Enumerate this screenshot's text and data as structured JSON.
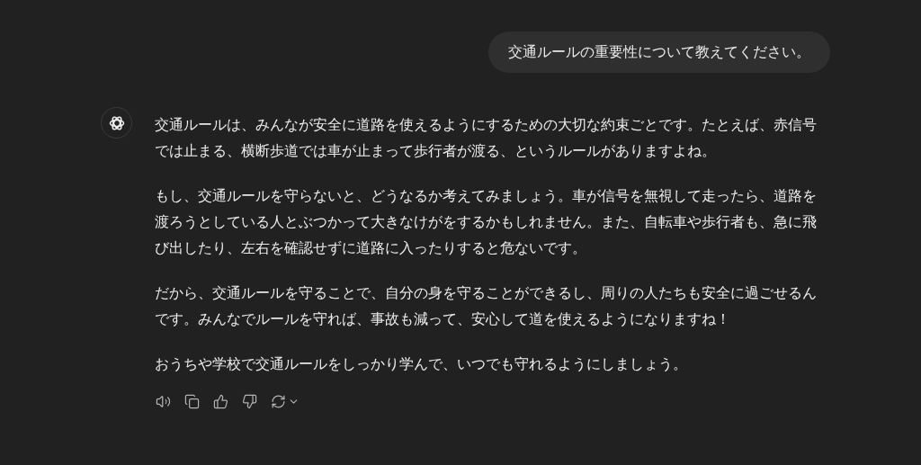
{
  "user_message": "交通ルールの重要性について教えてください。",
  "assistant_message": {
    "paragraphs": [
      "交通ルールは、みんなが安全に道路を使えるようにするための大切な約束ごとです。たとえば、赤信号では止まる、横断歩道では車が止まって歩行者が渡る、というルールがありますよね。",
      "もし、交通ルールを守らないと、どうなるか考えてみましょう。車が信号を無視して走ったら、道路を渡ろうとしている人とぶつかって大きなけがをするかもしれません。また、自転車や歩行者も、急に飛び出したり、左右を確認せずに道路に入ったりすると危ないです。",
      "だから、交通ルールを守ることで、自分の身を守ることができるし、周りの人たちも安全に過ごせるんです。みんなでルールを守れば、事故も減って、安心して道を使えるようになりますね！",
      "おうちや学校で交通ルールをしっかり学んで、いつでも守れるようにしましょう。"
    ],
    "actions": [
      {
        "kind": "read_aloud"
      },
      {
        "kind": "copy"
      },
      {
        "kind": "like"
      },
      {
        "kind": "dislike"
      },
      {
        "kind": "regenerate"
      }
    ]
  }
}
